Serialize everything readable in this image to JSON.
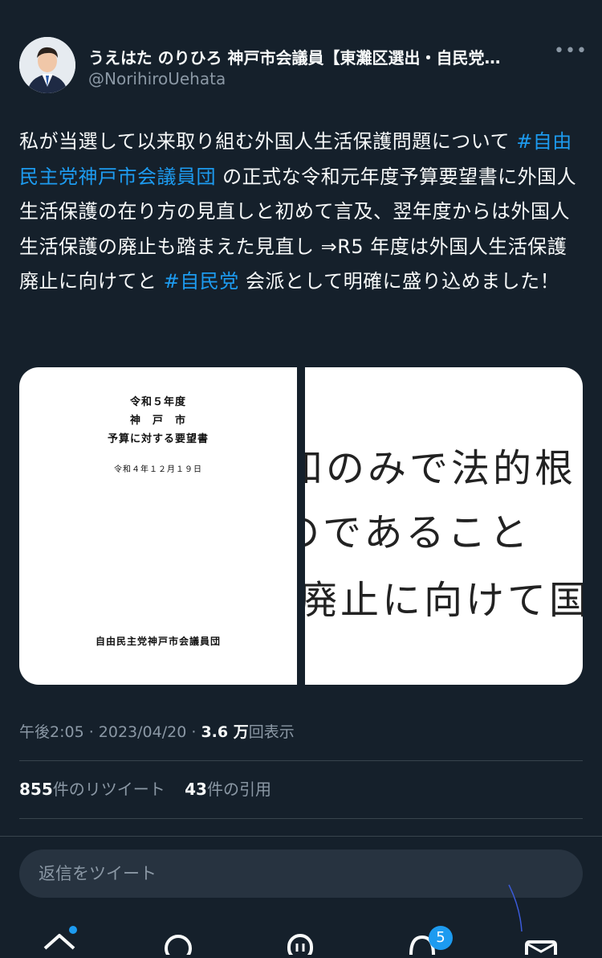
{
  "author": {
    "display_name": "うえはた のりひろ 神戸市会議員【東灘区選出・自民党…",
    "handle": "@NorihiroUehata",
    "more_icon": "more-horizontal-icon"
  },
  "tweet": {
    "segments": [
      {
        "text": "私が当選して以来取り組む外国人生活保護問題について ",
        "type": "text"
      },
      {
        "text": "#自由民主党神戸市会議員団",
        "type": "hashtag"
      },
      {
        "text": " の正式な令和元年度予算要望書に外国人生活保護の在り方の見直しと初めて言及、翌年度からは外国人生活保護の廃止も踏まえた見直し ⇒R5 年度は外国人生活保護廃止に向けてと ",
        "type": "text"
      },
      {
        "text": "#自民党",
        "type": "hashtag"
      },
      {
        "text": " 会派として明確に盛り込めました！",
        "type": "text"
      }
    ]
  },
  "media": {
    "left_doc": {
      "line1": "令和５年度",
      "line2": "神　戸　市",
      "line3": "予算に対する要望書",
      "date": "令和４年１２月１９日",
      "org": "自由民主党神戸市会議員団"
    },
    "right_zoom": {
      "line1": "和のみで法的根",
      "line2": "のであること",
      "line3": "廃止に向けて国"
    }
  },
  "meta": {
    "time": "午後2:05",
    "sep1": " · ",
    "date": "2023/04/20",
    "sep2": " · ",
    "views_num": "3.6 万",
    "views_label": "回表示"
  },
  "stats": {
    "retweets_num": "855",
    "retweets_label": "件のリツイート",
    "quotes_num": "43",
    "quotes_label": "件の引用"
  },
  "reply": {
    "placeholder": "返信をツイート"
  },
  "tabbar": {
    "items": [
      {
        "icon": "home-icon"
      },
      {
        "icon": "search-icon"
      },
      {
        "icon": "spaces-icon"
      },
      {
        "icon": "notifications-icon",
        "badge": "5"
      },
      {
        "icon": "messages-icon"
      }
    ]
  },
  "colors": {
    "background": "#15202b",
    "accent": "#1d9bf0",
    "secondary_text": "#8b98a5"
  }
}
